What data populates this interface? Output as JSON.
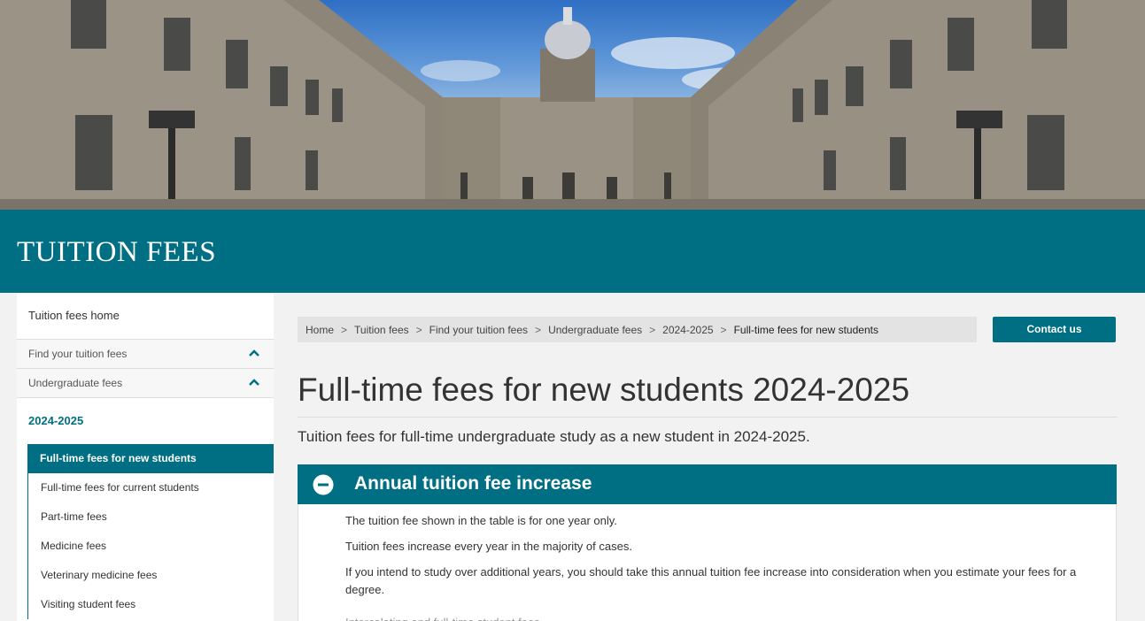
{
  "banner": {
    "title": "TUITION FEES"
  },
  "sidebar": {
    "home": "Tuition fees home",
    "sections": [
      {
        "label": "Find your tuition fees",
        "icon": "chevron-up-icon"
      },
      {
        "label": "Undergraduate fees",
        "icon": "chevron-up-icon"
      }
    ],
    "year": "2024-2025",
    "items": [
      {
        "label": "Full-time fees for new students"
      },
      {
        "label": "Full-time fees for current students"
      },
      {
        "label": "Part-time fees"
      },
      {
        "label": "Medicine fees"
      },
      {
        "label": "Veterinary medicine fees"
      },
      {
        "label": "Visiting student fees"
      }
    ]
  },
  "breadcrumb": {
    "items": [
      "Home",
      "Tuition fees",
      "Find your tuition fees",
      "Undergraduate fees",
      "2024-2025"
    ],
    "current": "Full-time fees for new students",
    "separator": ">"
  },
  "contact_button": "Contact us",
  "page": {
    "title": "Full-time fees for new students 2024-2025",
    "lead": "Tuition fees for full-time undergraduate study as a new student in 2024-2025."
  },
  "accordion": {
    "title": "Annual tuition fee increase",
    "icon": "minus-circle-icon",
    "paragraphs": [
      "The tuition fee shown in the table is for one year only.",
      "Tuition fees increase every year in the majority of cases.",
      "If you intend to study over additional years, you should take this annual tuition fee increase into consideration when you estimate your fees for a degree."
    ],
    "partial": "Intercalating and full-time student fees"
  },
  "colors": {
    "brand_teal": "#006f83",
    "breadcrumb_bg": "#e3e3e3"
  }
}
